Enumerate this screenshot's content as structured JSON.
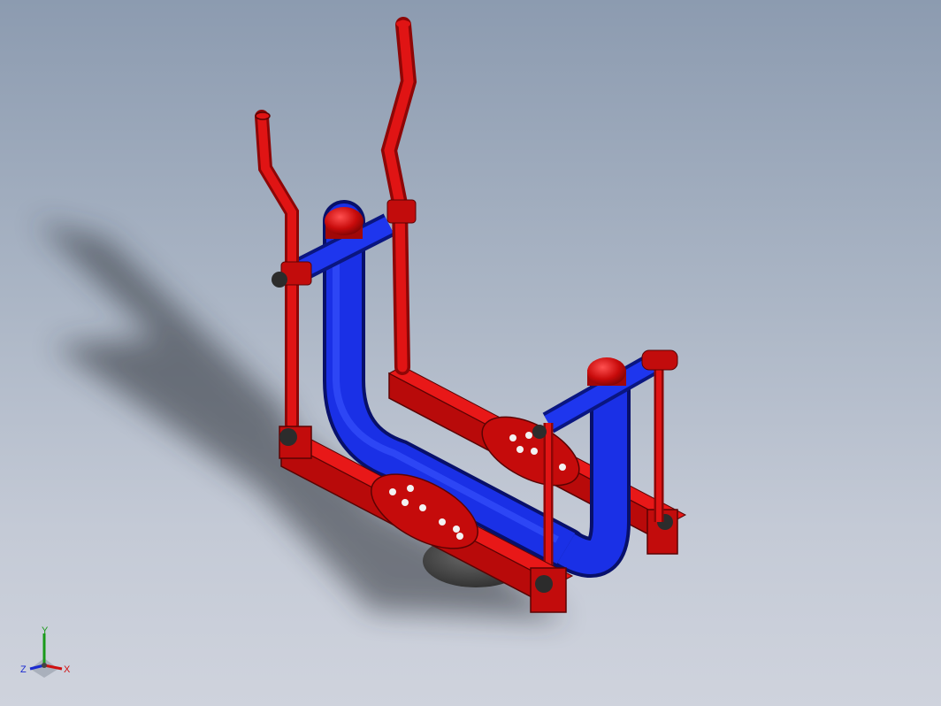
{
  "viewport": {
    "background_top": "#8c9bb0",
    "background_bottom": "#cfd3dd"
  },
  "model": {
    "name": "",
    "frame_color": "#d10d0d",
    "frame_shade": "#8e0606",
    "pipe_color": "#1226d6",
    "pipe_shade": "#0a1680",
    "base_color": "#3a3a3a",
    "shadow_color": "#2a2e36"
  },
  "triad": {
    "x_label": "X",
    "y_label": "Y",
    "z_label": "Z",
    "x_color": "#d01010",
    "y_color": "#1a9a1a",
    "z_color": "#1a2ad0"
  }
}
